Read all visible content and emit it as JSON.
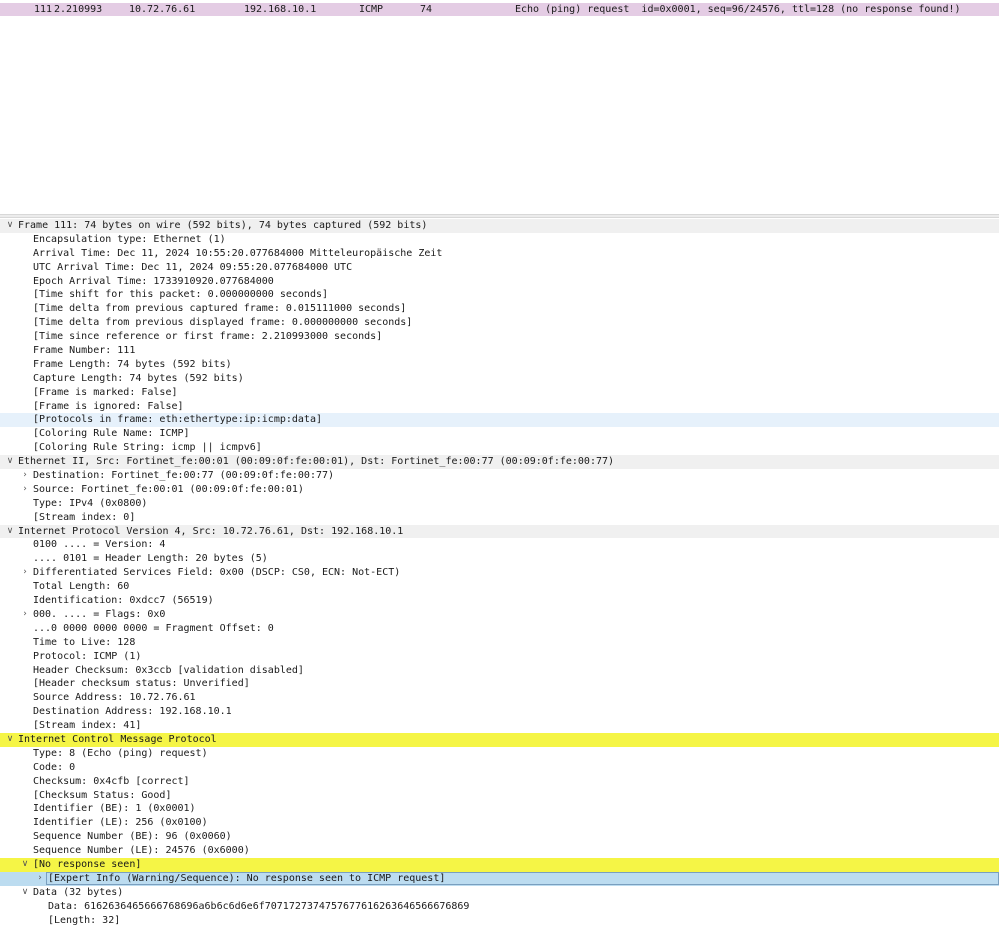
{
  "packet_list": {
    "row": {
      "no": "111",
      "time": "2.210993",
      "source": "10.72.76.61",
      "destination": "192.168.10.1",
      "protocol": "ICMP",
      "length": "74",
      "info": "Echo (ping) request  id=0x0001, seq=96/24576, ttl=128 (no response found!)"
    }
  },
  "details": [
    {
      "text": "Frame 111: 74 bytes on wire (592 bits), 74 bytes captured (592 bits)",
      "level": 0,
      "arrow": "expanded",
      "style": "header"
    },
    {
      "text": "Encapsulation type: Ethernet (1)",
      "level": 1
    },
    {
      "text": "Arrival Time: Dec 11, 2024 10:55:20.077684000 Mitteleuropäische Zeit",
      "level": 1
    },
    {
      "text": "UTC Arrival Time: Dec 11, 2024 09:55:20.077684000 UTC",
      "level": 1
    },
    {
      "text": "Epoch Arrival Time: 1733910920.077684000",
      "level": 1
    },
    {
      "text": "[Time shift for this packet: 0.000000000 seconds]",
      "level": 1
    },
    {
      "text": "[Time delta from previous captured frame: 0.015111000 seconds]",
      "level": 1
    },
    {
      "text": "[Time delta from previous displayed frame: 0.000000000 seconds]",
      "level": 1
    },
    {
      "text": "[Time since reference or first frame: 2.210993000 seconds]",
      "level": 1
    },
    {
      "text": "Frame Number: 111",
      "level": 1
    },
    {
      "text": "Frame Length: 74 bytes (592 bits)",
      "level": 1
    },
    {
      "text": "Capture Length: 74 bytes (592 bits)",
      "level": 1
    },
    {
      "text": "[Frame is marked: False]",
      "level": 1
    },
    {
      "text": "[Frame is ignored: False]",
      "level": 1
    },
    {
      "text": "[Protocols in frame: eth:ethertype:ip:icmp:data]",
      "level": 1,
      "style": "hl-blue"
    },
    {
      "text": "[Coloring Rule Name: ICMP]",
      "level": 1
    },
    {
      "text": "[Coloring Rule String: icmp || icmpv6]",
      "level": 1
    },
    {
      "text": "Ethernet II, Src: Fortinet_fe:00:01 (00:09:0f:fe:00:01), Dst: Fortinet_fe:00:77 (00:09:0f:fe:00:77)",
      "level": 0,
      "arrow": "expanded",
      "style": "header"
    },
    {
      "text": "Destination: Fortinet_fe:00:77 (00:09:0f:fe:00:77)",
      "level": 1,
      "arrow": "collapsed"
    },
    {
      "text": "Source: Fortinet_fe:00:01 (00:09:0f:fe:00:01)",
      "level": 1,
      "arrow": "collapsed"
    },
    {
      "text": "Type: IPv4 (0x0800)",
      "level": 1
    },
    {
      "text": "[Stream index: 0]",
      "level": 1
    },
    {
      "text": "Internet Protocol Version 4, Src: 10.72.76.61, Dst: 192.168.10.1",
      "level": 0,
      "arrow": "expanded",
      "style": "header"
    },
    {
      "text": "0100 .... = Version: 4",
      "level": 1
    },
    {
      "text": ".... 0101 = Header Length: 20 bytes (5)",
      "level": 1
    },
    {
      "text": "Differentiated Services Field: 0x00 (DSCP: CS0, ECN: Not-ECT)",
      "level": 1,
      "arrow": "collapsed"
    },
    {
      "text": "Total Length: 60",
      "level": 1
    },
    {
      "text": "Identification: 0xdcc7 (56519)",
      "level": 1
    },
    {
      "text": "000. .... = Flags: 0x0",
      "level": 1,
      "arrow": "collapsed"
    },
    {
      "text": "...0 0000 0000 0000 = Fragment Offset: 0",
      "level": 1
    },
    {
      "text": "Time to Live: 128",
      "level": 1
    },
    {
      "text": "Protocol: ICMP (1)",
      "level": 1
    },
    {
      "text": "Header Checksum: 0x3ccb [validation disabled]",
      "level": 1
    },
    {
      "text": "[Header checksum status: Unverified]",
      "level": 1
    },
    {
      "text": "Source Address: 10.72.76.61",
      "level": 1
    },
    {
      "text": "Destination Address: 192.168.10.1",
      "level": 1
    },
    {
      "text": "[Stream index: 41]",
      "level": 1
    },
    {
      "text": "Internet Control Message Protocol",
      "level": 0,
      "arrow": "expanded",
      "style": "yellow"
    },
    {
      "text": "Type: 8 (Echo (ping) request)",
      "level": 1
    },
    {
      "text": "Code: 0",
      "level": 1
    },
    {
      "text": "Checksum: 0x4cfb [correct]",
      "level": 1
    },
    {
      "text": "[Checksum Status: Good]",
      "level": 1
    },
    {
      "text": "Identifier (BE): 1 (0x0001)",
      "level": 1
    },
    {
      "text": "Identifier (LE): 256 (0x0100)",
      "level": 1
    },
    {
      "text": "Sequence Number (BE): 96 (0x0060)",
      "level": 1
    },
    {
      "text": "Sequence Number (LE): 24576 (0x6000)",
      "level": 1
    },
    {
      "text": "[No response seen]",
      "level": 1,
      "arrow": "expanded",
      "style": "yellow"
    },
    {
      "text": "[Expert Info (Warning/Sequence): No response seen to ICMP request]",
      "level": 2,
      "arrow": "collapsed",
      "style": "expert"
    },
    {
      "text": "Data (32 bytes)",
      "level": 1,
      "arrow": "expanded"
    },
    {
      "text": "Data: 6162636465666768696a6b6c6d6e6f7071727374757677616263646566676869",
      "level": 2
    },
    {
      "text": "[Length: 32]",
      "level": 2
    }
  ]
}
